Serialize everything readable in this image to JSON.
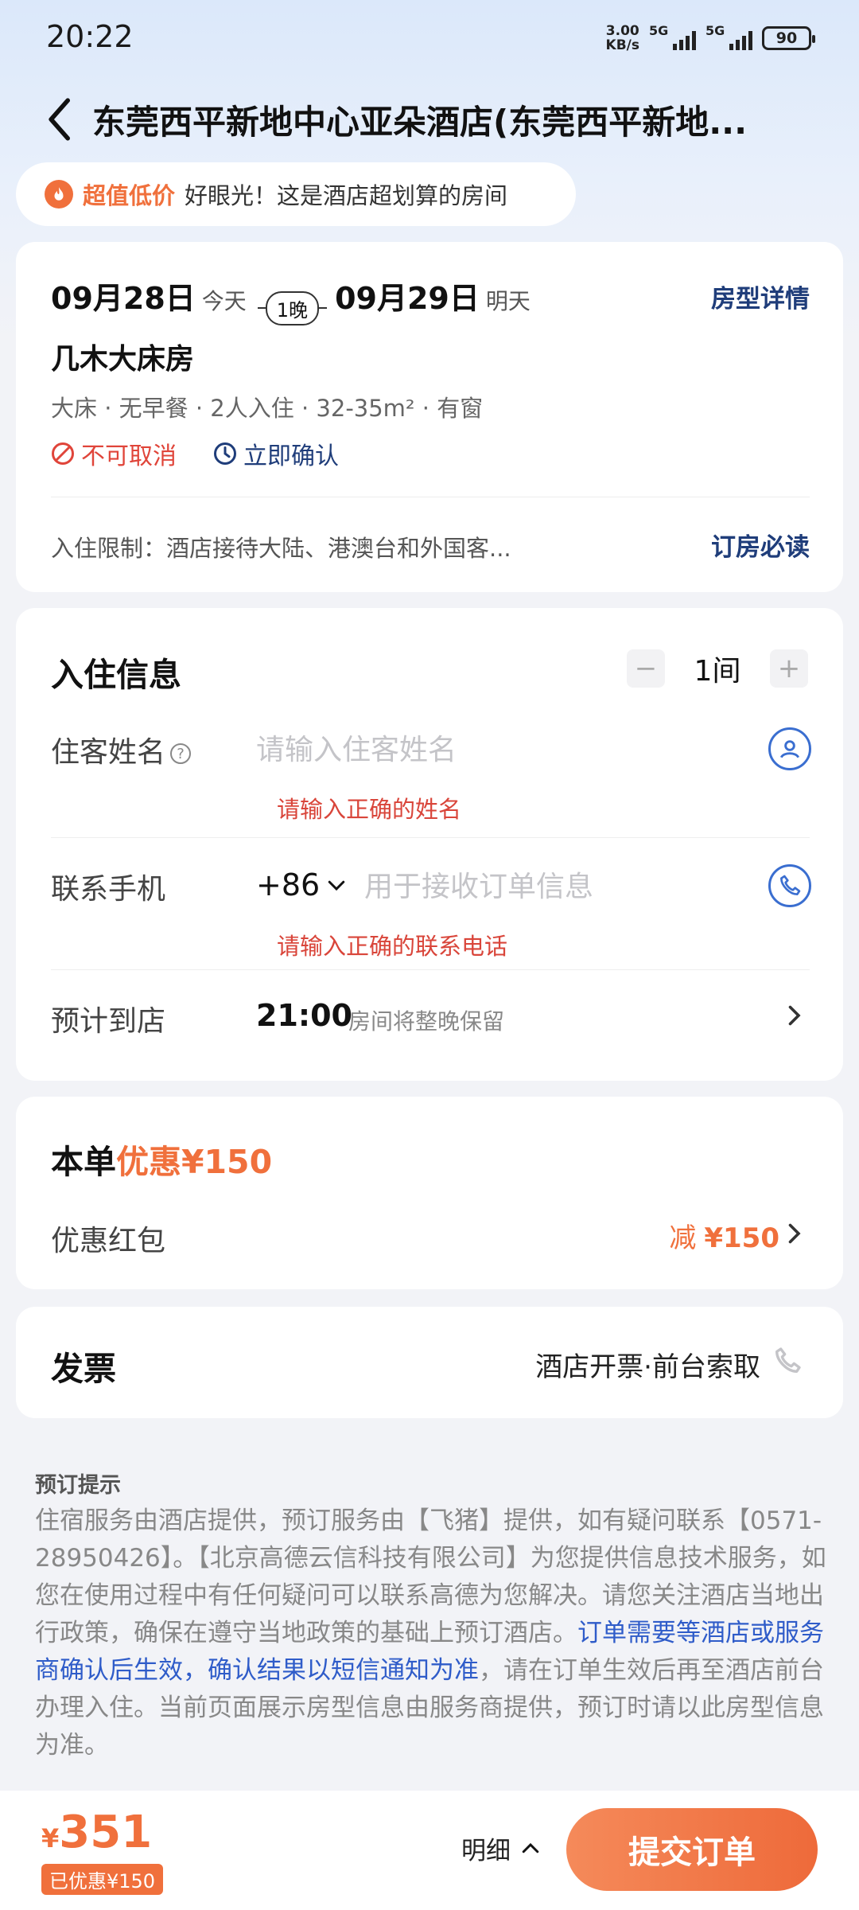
{
  "status_bar": {
    "time": "20:22",
    "net_speed_value": "3.00",
    "net_speed_unit": "KB/s",
    "network_1": "5G",
    "network_2": "5G",
    "battery": "90"
  },
  "header": {
    "title": "东莞西平新地中心亚朵酒店(东莞西平新地..."
  },
  "promo": {
    "tag": "超值低价",
    "text": "好眼光！这是酒店超划算的房间"
  },
  "room": {
    "checkin_date": "09月28日",
    "checkin_label": "今天",
    "nights": "1晚",
    "checkout_date": "09月29日",
    "checkout_label": "明天",
    "detail_link": "房型详情",
    "name": "几木大床房",
    "attributes": "大床 · 无早餐 · 2人入住 · 32-35m² · 有窗",
    "cancel_policy": "不可取消",
    "confirm_policy": "立即确认",
    "restriction": "入住限制：酒店接待大陆、港澳台和外国客...",
    "booking_notes_link": "订房必读"
  },
  "guest": {
    "title": "入住信息",
    "rooms_count": "1间",
    "minus": "−",
    "plus": "+",
    "name_label": "住客姓名",
    "name_placeholder": "请输入住客姓名",
    "name_error": "请输入正确的姓名",
    "phone_label": "联系手机",
    "country_code": "+86",
    "phone_placeholder": "用于接收订单信息",
    "phone_error": "请输入正确的联系电话",
    "arrival_label": "预计到店",
    "arrival_time": "21:00",
    "arrival_note": "房间将整晚保留"
  },
  "discount": {
    "title_prefix": "本单",
    "title_highlight": "优惠¥150",
    "redpack_label": "优惠红包",
    "redpack_prefix": "减",
    "redpack_amount": "¥150"
  },
  "invoice": {
    "title": "发票",
    "value": "酒店开票·前台索取"
  },
  "notice": {
    "title": "预订提示",
    "text_1": "住宿服务由酒店提供，预订服务由【飞猪】提供，如有疑问联系【0571-28950426】。【北京高德云信科技有限公司】为您提供信息技术服务，如您在使用过程中有任何疑问可以联系高德为您解决。请您关注酒店当地出行政策，确保在遵守当地政策的基础上预订酒店。",
    "text_highlight": "订单需要等酒店或服务商确认后生效，确认结果以短信通知为准",
    "text_2": "，请在订单生效后再至酒店前台办理入住。当前页面展示房型信息由服务商提供，预订时请以此房型信息为准。"
  },
  "bottom": {
    "currency": "¥",
    "total": "351",
    "saved": "已优惠¥150",
    "detail": "明细",
    "submit": "提交订单"
  },
  "colors": {
    "accent_orange": "#f0703c",
    "link_blue": "#1f3d7a",
    "error_red": "#d9453a",
    "icon_blue": "#3a6ed0"
  }
}
